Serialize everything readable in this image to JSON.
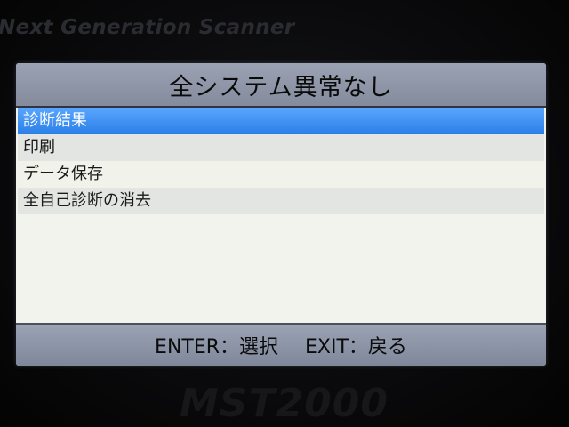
{
  "device": {
    "brand_top": "Next Generation Scanner",
    "model": "MST2000"
  },
  "screen": {
    "title": "全システム異常なし",
    "menu": [
      {
        "label": "診断結果",
        "selected": true
      },
      {
        "label": "印刷",
        "selected": false
      },
      {
        "label": "データ保存",
        "selected": false
      },
      {
        "label": "全自己診断の消去",
        "selected": false
      }
    ],
    "footer": {
      "enter_hint": "ENTER：選択",
      "exit_hint": "EXIT：戻る"
    }
  },
  "colors": {
    "selection": "#2a7fe6",
    "bar": "#8a92a4",
    "background": "#f2f3ec"
  }
}
